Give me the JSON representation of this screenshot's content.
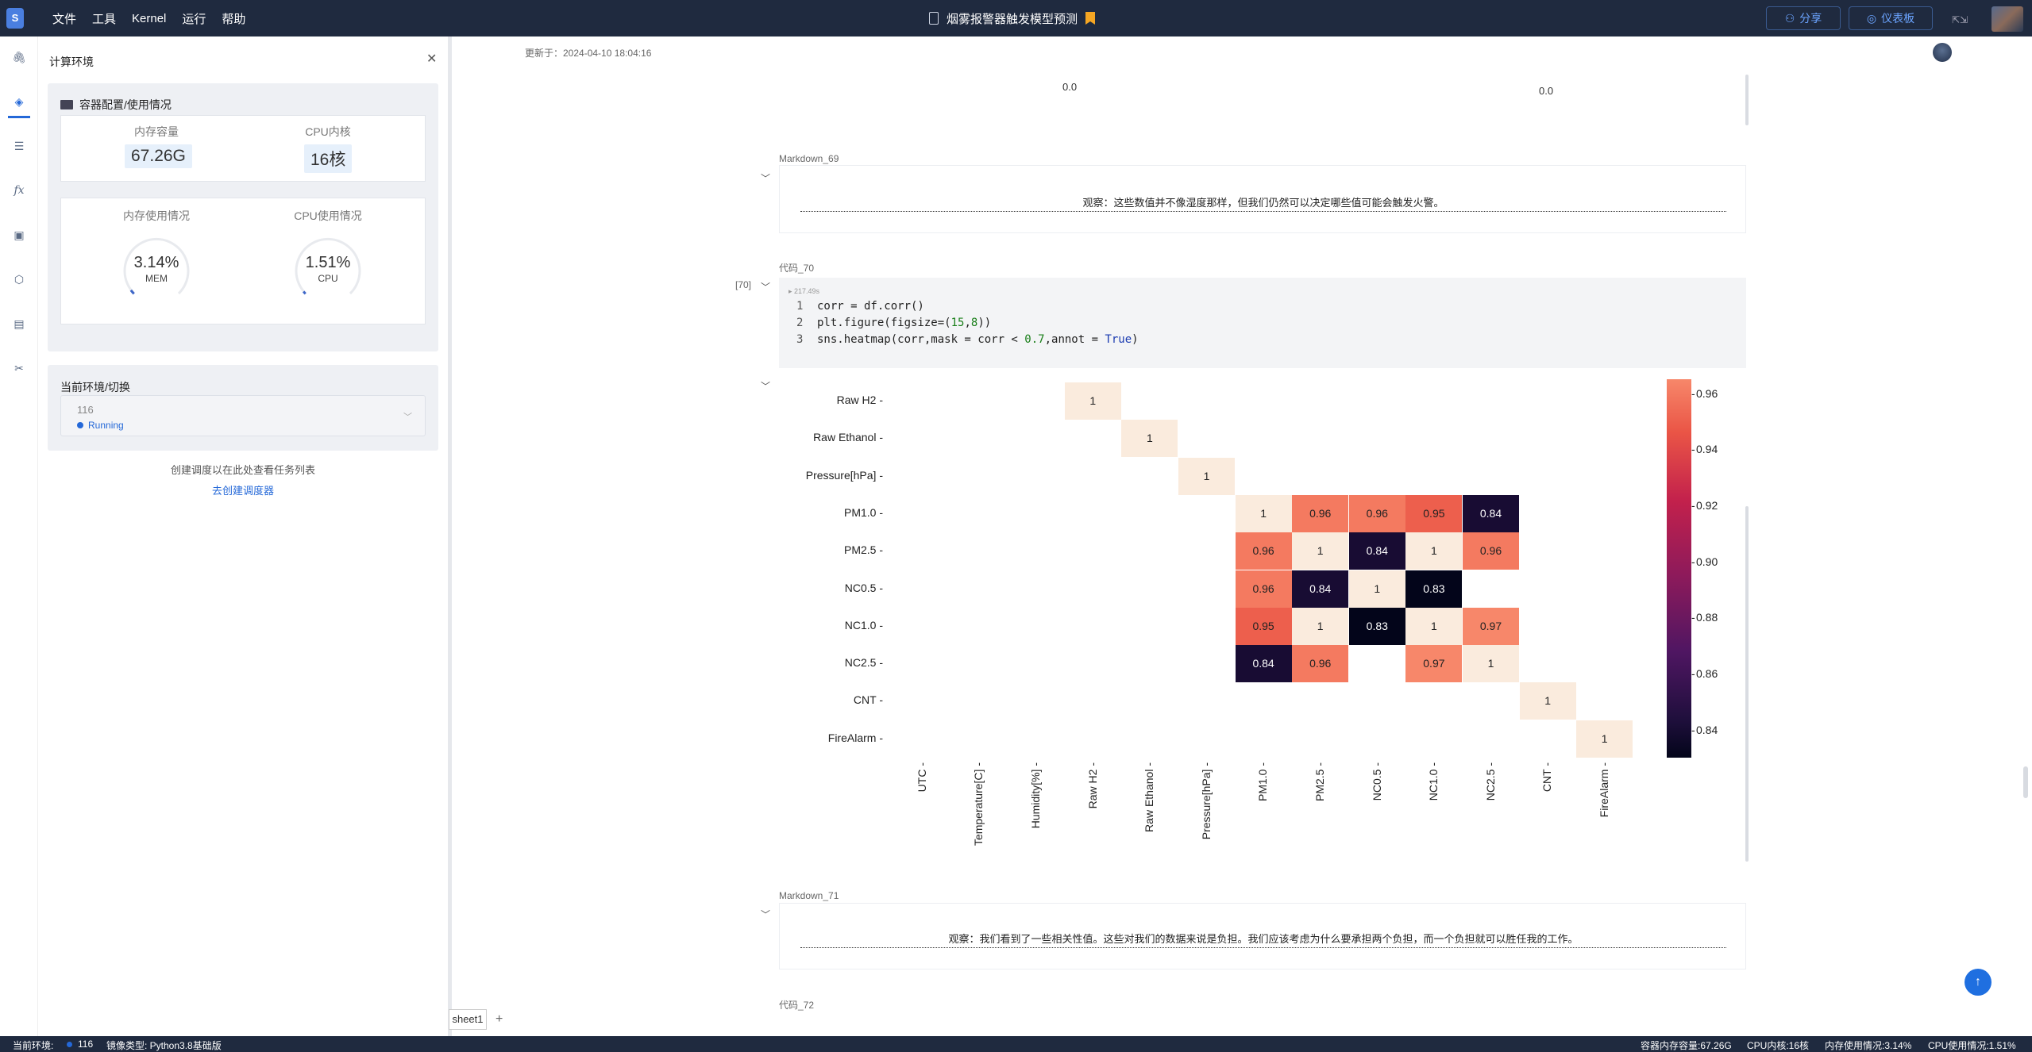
{
  "topbar": {
    "logo": "S",
    "menu": [
      "文件",
      "工具",
      "Kernel",
      "运行",
      "帮助"
    ],
    "title": "烟雾报警器触发模型预测",
    "share_label": "分享",
    "dashboard_label": "仪表板"
  },
  "panel": {
    "title": "计算环境",
    "card_title": "容器配置/使用情况",
    "memory_label": "内存容量",
    "memory_value": "67.26G",
    "cpu_label": "CPU内核",
    "cpu_value": "16核",
    "mem_usage_label": "内存使用情况",
    "cpu_usage_label": "CPU使用情况",
    "mem_percent": "3.14%",
    "mem_unit": "MEM",
    "mem_fraction": 0.0314,
    "cpu_percent": "1.51%",
    "cpu_unit": "CPU",
    "cpu_fraction": 0.0151,
    "env_title": "当前环境/切换",
    "env_value": "116",
    "env_status": "Running",
    "schedule_hint": "创建调度以在此处查看任务列表",
    "schedule_link": "去创建调度器"
  },
  "sheet": {
    "tab": "sheet1",
    "add": "+"
  },
  "notebook": {
    "updated": "更新于：2024-04-10 18:04:16",
    "top_values": [
      "0.0",
      "0.0"
    ],
    "md69_label": "Markdown_69",
    "md69_text": "观察：这些数值并不像湿度那样，但我们仍然可以决定哪些值可能会触发火警。",
    "code70_label": "代码_70",
    "exec_count": "[70]",
    "exec_time": "217.49s",
    "code_lines": [
      {
        "n": "1",
        "segments": [
          {
            "t": "corr = df.corr()",
            "c": ""
          }
        ]
      },
      {
        "n": "2",
        "segments": [
          {
            "t": "plt.figure(figsize=(",
            "c": ""
          },
          {
            "t": "15",
            "c": "g"
          },
          {
            "t": ",",
            "c": ""
          },
          {
            "t": "8",
            "c": "g"
          },
          {
            "t": "))",
            "c": ""
          }
        ]
      },
      {
        "n": "3",
        "segments": [
          {
            "t": "sns.heatmap(corr,mask = corr < ",
            "c": ""
          },
          {
            "t": "0.7",
            "c": "g"
          },
          {
            "t": ",annot = ",
            "c": ""
          },
          {
            "t": "True",
            "c": "b"
          },
          {
            "t": ")",
            "c": ""
          }
        ]
      }
    ],
    "md71_label": "Markdown_71",
    "md71_text": "观察：我们看到了一些相关性值。这些对我们的数据来说是负担。我们应该考虑为什么要承担两个负担，而一个负担就可以胜任我的工作。",
    "code72_label": "代码_72"
  },
  "chart_data": {
    "type": "heatmap",
    "row_labels": [
      "Raw H2",
      "Raw Ethanol",
      "Pressure[hPa]",
      "PM1.0",
      "PM2.5",
      "NC0.5",
      "NC1.0",
      "NC2.5",
      "CNT",
      "FireAlarm"
    ],
    "col_labels": [
      "UTC",
      "Temperature[C]",
      "Humidity[%]",
      "Raw H2",
      "Raw Ethanol",
      "Pressure[hPa]",
      "PM1.0",
      "PM2.5",
      "NC0.5",
      "NC1.0",
      "NC2.5",
      "CNT",
      "FireAlarm"
    ],
    "cells": [
      {
        "row": "Raw H2",
        "col": "Raw H2",
        "value": 1,
        "label": "1"
      },
      {
        "row": "Raw Ethanol",
        "col": "Raw Ethanol",
        "value": 1,
        "label": "1"
      },
      {
        "row": "Pressure[hPa]",
        "col": "Pressure[hPa]",
        "value": 1,
        "label": "1"
      },
      {
        "row": "PM1.0",
        "col": "PM1.0",
        "value": 1,
        "label": "1"
      },
      {
        "row": "PM1.0",
        "col": "PM2.5",
        "value": 0.96,
        "label": "0.96"
      },
      {
        "row": "PM1.0",
        "col": "NC0.5",
        "value": 0.96,
        "label": "0.96"
      },
      {
        "row": "PM1.0",
        "col": "NC1.0",
        "value": 0.95,
        "label": "0.95"
      },
      {
        "row": "PM1.0",
        "col": "NC2.5",
        "value": 0.84,
        "label": "0.84"
      },
      {
        "row": "PM2.5",
        "col": "PM1.0",
        "value": 0.96,
        "label": "0.96"
      },
      {
        "row": "PM2.5",
        "col": "PM2.5",
        "value": 1,
        "label": "1"
      },
      {
        "row": "PM2.5",
        "col": "NC0.5",
        "value": 0.84,
        "label": "0.84"
      },
      {
        "row": "PM2.5",
        "col": "NC1.0",
        "value": 1,
        "label": "1"
      },
      {
        "row": "PM2.5",
        "col": "NC2.5",
        "value": 0.96,
        "label": "0.96"
      },
      {
        "row": "NC0.5",
        "col": "PM1.0",
        "value": 0.96,
        "label": "0.96"
      },
      {
        "row": "NC0.5",
        "col": "PM2.5",
        "value": 0.84,
        "label": "0.84"
      },
      {
        "row": "NC0.5",
        "col": "NC0.5",
        "value": 1,
        "label": "1"
      },
      {
        "row": "NC0.5",
        "col": "NC1.0",
        "value": 0.83,
        "label": "0.83"
      },
      {
        "row": "NC1.0",
        "col": "PM1.0",
        "value": 0.95,
        "label": "0.95"
      },
      {
        "row": "NC1.0",
        "col": "PM2.5",
        "value": 1,
        "label": "1"
      },
      {
        "row": "NC1.0",
        "col": "NC0.5",
        "value": 0.83,
        "label": "0.83"
      },
      {
        "row": "NC1.0",
        "col": "NC1.0",
        "value": 1,
        "label": "1"
      },
      {
        "row": "NC1.0",
        "col": "NC2.5",
        "value": 0.97,
        "label": "0.97"
      },
      {
        "row": "NC2.5",
        "col": "PM1.0",
        "value": 0.84,
        "label": "0.84"
      },
      {
        "row": "NC2.5",
        "col": "PM2.5",
        "value": 0.96,
        "label": "0.96"
      },
      {
        "row": "NC2.5",
        "col": "NC1.0",
        "value": 0.97,
        "label": "0.97"
      },
      {
        "row": "NC2.5",
        "col": "NC2.5",
        "value": 1,
        "label": "1"
      },
      {
        "row": "CNT",
        "col": "CNT",
        "value": 1,
        "label": "1"
      },
      {
        "row": "FireAlarm",
        "col": "FireAlarm",
        "value": 1,
        "label": "1"
      }
    ],
    "colorbar_ticks": [
      "0.96",
      "0.94",
      "0.92",
      "0.90",
      "0.88",
      "0.86",
      "0.84"
    ],
    "colorbar_range": [
      0.83,
      0.965
    ],
    "colors": {
      "one": "#faebdd",
      "high": "#f7876a",
      "low": "#03051a"
    }
  },
  "statusbar": {
    "env_label": "当前环境:",
    "env_value": "116",
    "image_label": "镜像类型: Python3.8基础版",
    "memory": "容器内存容量:67.26G",
    "cpu": "CPU内核:16核",
    "mem_usage": "内存使用情况:3.14%",
    "cpu_usage": "CPU使用情况:1.51%"
  }
}
